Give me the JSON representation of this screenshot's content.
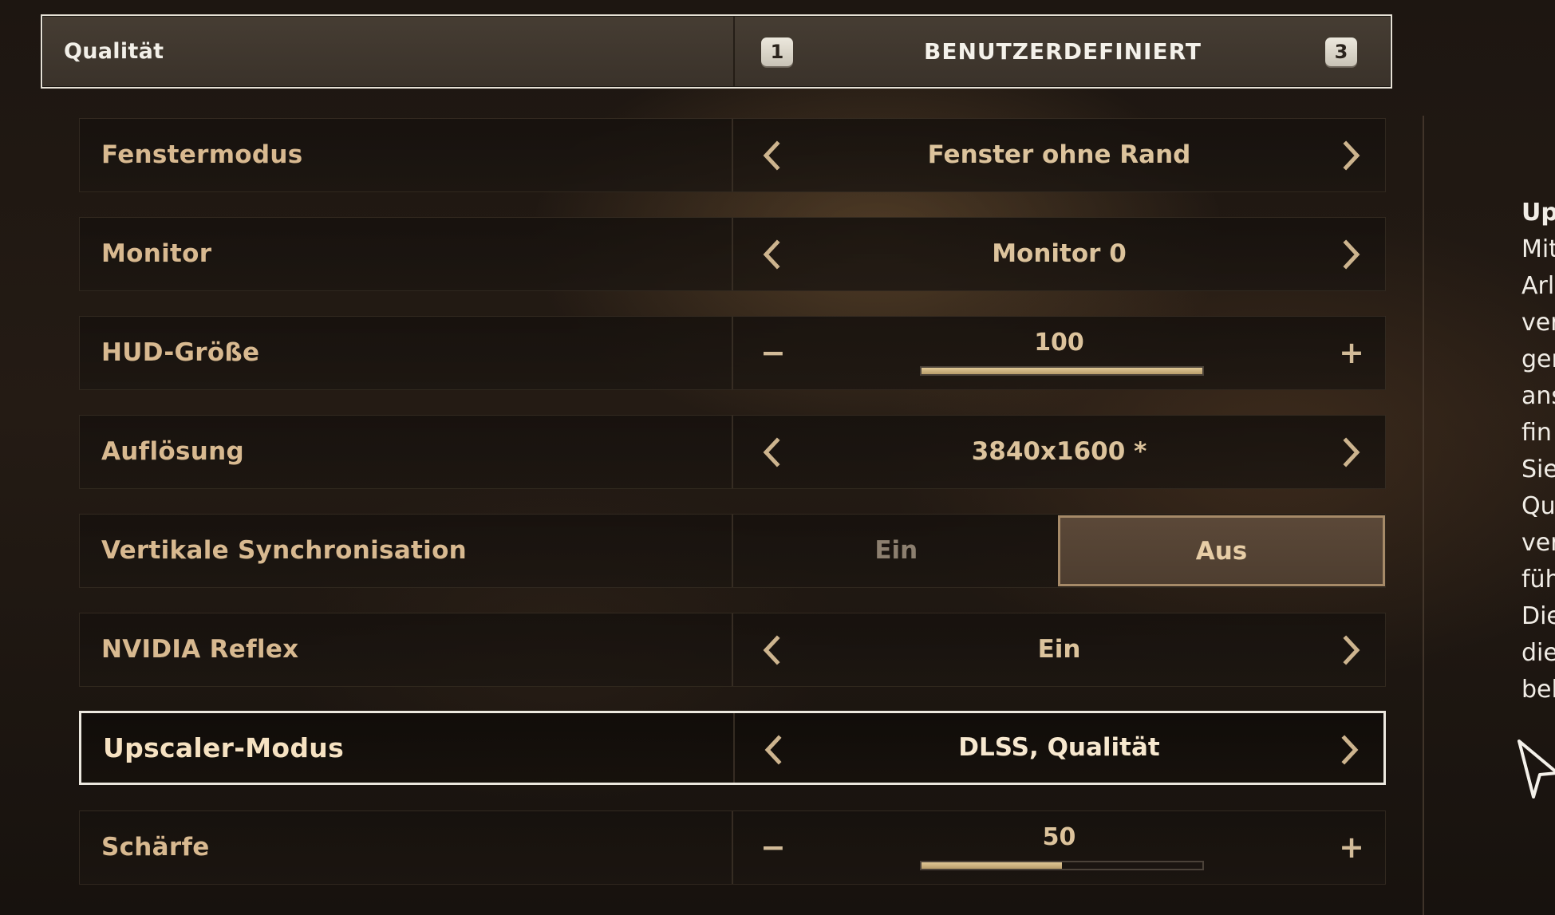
{
  "quality": {
    "label": "Qualität",
    "value": "BENUTZERDEFINIERT",
    "key_left": "1",
    "key_right": "3"
  },
  "settings": [
    {
      "name": "Fenstermodus",
      "type": "selector",
      "value": "Fenster ohne Rand"
    },
    {
      "name": "Monitor",
      "type": "selector",
      "value": "Monitor 0"
    },
    {
      "name": "HUD-Größe",
      "type": "slider",
      "value": "100",
      "level": 1.0
    },
    {
      "name": "Auflösung",
      "type": "selector",
      "value": "3840x1600 *"
    },
    {
      "name": "Vertikale Synchronisation",
      "type": "toggle",
      "options": [
        "Ein",
        "Aus"
      ],
      "selected": "Aus"
    },
    {
      "name": "NVIDIA Reflex",
      "type": "selector",
      "value": "Ein"
    },
    {
      "name": "Upscaler-Modus",
      "type": "selector",
      "value": "DLSS, Qualität",
      "selected_row": true
    },
    {
      "name": "Schärfe",
      "type": "slider",
      "value": "50",
      "level": 0.5
    }
  ],
  "slider_controls": {
    "minus": "−",
    "plus": "+"
  },
  "description": {
    "title": "Up",
    "lines": [
      "Mit",
      "Arl",
      "ver",
      "ger",
      "ans",
      "fin",
      "Sie",
      "Qu",
      "ver",
      "füh",
      "Die",
      "die",
      "bel"
    ]
  },
  "colors": {
    "accent_text": "#d8b990",
    "selected_border": "#ece8df",
    "slider_fill": "#d4bb88",
    "toggle_active_bg": "#56443a"
  }
}
